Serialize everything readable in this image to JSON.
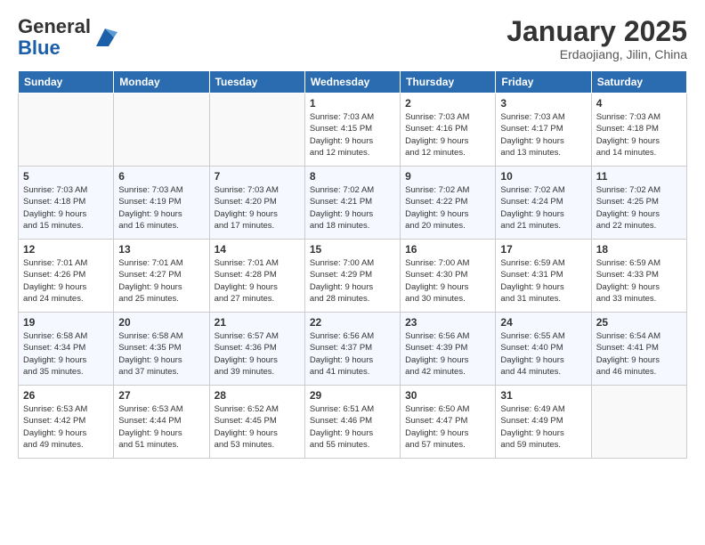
{
  "logo": {
    "general": "General",
    "blue": "Blue"
  },
  "header": {
    "month": "January 2025",
    "location": "Erdaojiang, Jilin, China"
  },
  "weekdays": [
    "Sunday",
    "Monday",
    "Tuesday",
    "Wednesday",
    "Thursday",
    "Friday",
    "Saturday"
  ],
  "weeks": [
    [
      {
        "day": "",
        "info": ""
      },
      {
        "day": "",
        "info": ""
      },
      {
        "day": "",
        "info": ""
      },
      {
        "day": "1",
        "info": "Sunrise: 7:03 AM\nSunset: 4:15 PM\nDaylight: 9 hours\nand 12 minutes."
      },
      {
        "day": "2",
        "info": "Sunrise: 7:03 AM\nSunset: 4:16 PM\nDaylight: 9 hours\nand 12 minutes."
      },
      {
        "day": "3",
        "info": "Sunrise: 7:03 AM\nSunset: 4:17 PM\nDaylight: 9 hours\nand 13 minutes."
      },
      {
        "day": "4",
        "info": "Sunrise: 7:03 AM\nSunset: 4:18 PM\nDaylight: 9 hours\nand 14 minutes."
      }
    ],
    [
      {
        "day": "5",
        "info": "Sunrise: 7:03 AM\nSunset: 4:18 PM\nDaylight: 9 hours\nand 15 minutes."
      },
      {
        "day": "6",
        "info": "Sunrise: 7:03 AM\nSunset: 4:19 PM\nDaylight: 9 hours\nand 16 minutes."
      },
      {
        "day": "7",
        "info": "Sunrise: 7:03 AM\nSunset: 4:20 PM\nDaylight: 9 hours\nand 17 minutes."
      },
      {
        "day": "8",
        "info": "Sunrise: 7:02 AM\nSunset: 4:21 PM\nDaylight: 9 hours\nand 18 minutes."
      },
      {
        "day": "9",
        "info": "Sunrise: 7:02 AM\nSunset: 4:22 PM\nDaylight: 9 hours\nand 20 minutes."
      },
      {
        "day": "10",
        "info": "Sunrise: 7:02 AM\nSunset: 4:24 PM\nDaylight: 9 hours\nand 21 minutes."
      },
      {
        "day": "11",
        "info": "Sunrise: 7:02 AM\nSunset: 4:25 PM\nDaylight: 9 hours\nand 22 minutes."
      }
    ],
    [
      {
        "day": "12",
        "info": "Sunrise: 7:01 AM\nSunset: 4:26 PM\nDaylight: 9 hours\nand 24 minutes."
      },
      {
        "day": "13",
        "info": "Sunrise: 7:01 AM\nSunset: 4:27 PM\nDaylight: 9 hours\nand 25 minutes."
      },
      {
        "day": "14",
        "info": "Sunrise: 7:01 AM\nSunset: 4:28 PM\nDaylight: 9 hours\nand 27 minutes."
      },
      {
        "day": "15",
        "info": "Sunrise: 7:00 AM\nSunset: 4:29 PM\nDaylight: 9 hours\nand 28 minutes."
      },
      {
        "day": "16",
        "info": "Sunrise: 7:00 AM\nSunset: 4:30 PM\nDaylight: 9 hours\nand 30 minutes."
      },
      {
        "day": "17",
        "info": "Sunrise: 6:59 AM\nSunset: 4:31 PM\nDaylight: 9 hours\nand 31 minutes."
      },
      {
        "day": "18",
        "info": "Sunrise: 6:59 AM\nSunset: 4:33 PM\nDaylight: 9 hours\nand 33 minutes."
      }
    ],
    [
      {
        "day": "19",
        "info": "Sunrise: 6:58 AM\nSunset: 4:34 PM\nDaylight: 9 hours\nand 35 minutes."
      },
      {
        "day": "20",
        "info": "Sunrise: 6:58 AM\nSunset: 4:35 PM\nDaylight: 9 hours\nand 37 minutes."
      },
      {
        "day": "21",
        "info": "Sunrise: 6:57 AM\nSunset: 4:36 PM\nDaylight: 9 hours\nand 39 minutes."
      },
      {
        "day": "22",
        "info": "Sunrise: 6:56 AM\nSunset: 4:37 PM\nDaylight: 9 hours\nand 41 minutes."
      },
      {
        "day": "23",
        "info": "Sunrise: 6:56 AM\nSunset: 4:39 PM\nDaylight: 9 hours\nand 42 minutes."
      },
      {
        "day": "24",
        "info": "Sunrise: 6:55 AM\nSunset: 4:40 PM\nDaylight: 9 hours\nand 44 minutes."
      },
      {
        "day": "25",
        "info": "Sunrise: 6:54 AM\nSunset: 4:41 PM\nDaylight: 9 hours\nand 46 minutes."
      }
    ],
    [
      {
        "day": "26",
        "info": "Sunrise: 6:53 AM\nSunset: 4:42 PM\nDaylight: 9 hours\nand 49 minutes."
      },
      {
        "day": "27",
        "info": "Sunrise: 6:53 AM\nSunset: 4:44 PM\nDaylight: 9 hours\nand 51 minutes."
      },
      {
        "day": "28",
        "info": "Sunrise: 6:52 AM\nSunset: 4:45 PM\nDaylight: 9 hours\nand 53 minutes."
      },
      {
        "day": "29",
        "info": "Sunrise: 6:51 AM\nSunset: 4:46 PM\nDaylight: 9 hours\nand 55 minutes."
      },
      {
        "day": "30",
        "info": "Sunrise: 6:50 AM\nSunset: 4:47 PM\nDaylight: 9 hours\nand 57 minutes."
      },
      {
        "day": "31",
        "info": "Sunrise: 6:49 AM\nSunset: 4:49 PM\nDaylight: 9 hours\nand 59 minutes."
      },
      {
        "day": "",
        "info": ""
      }
    ]
  ]
}
